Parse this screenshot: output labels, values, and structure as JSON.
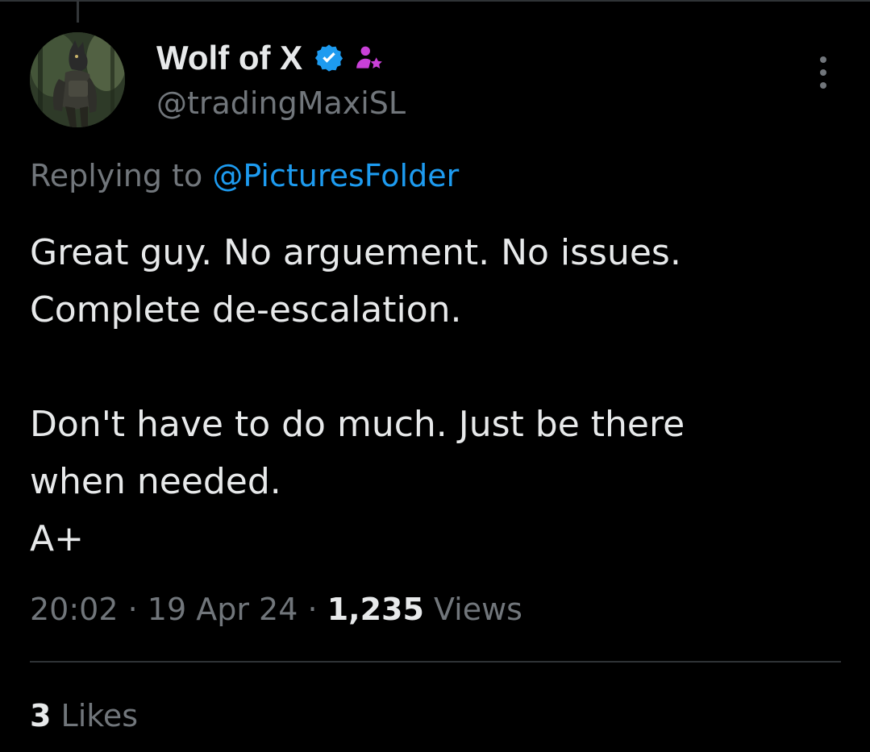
{
  "tweet": {
    "author": {
      "display_name": "Wolf of X",
      "handle": "@tradingMaxiSL",
      "verified_color": "#1d9bf0",
      "affiliate_badge_color": "#c940d8",
      "avatar_icon": "wolf-warrior-avatar"
    },
    "replying_label": "Replying to",
    "replying_to": "@PicturesFolder",
    "body": {
      "line1": "Great guy. No arguement. No issues.",
      "line2": "Complete de-escalation.",
      "line3": "Don't have to do much. Just be there",
      "line4": "when needed.",
      "line5": "A+"
    },
    "meta": {
      "time": "20:02",
      "separator": "·",
      "date": "19 Apr 24",
      "views_count": "1,235",
      "views_label": "Views"
    },
    "likes": {
      "count": "3",
      "label": "Likes"
    },
    "more_icon": "more-vertical-icon"
  },
  "colors": {
    "background": "#000000",
    "text_primary": "#e7e9ea",
    "text_secondary": "#71767b",
    "link": "#1d9bf0",
    "divider": "#2f3336"
  }
}
